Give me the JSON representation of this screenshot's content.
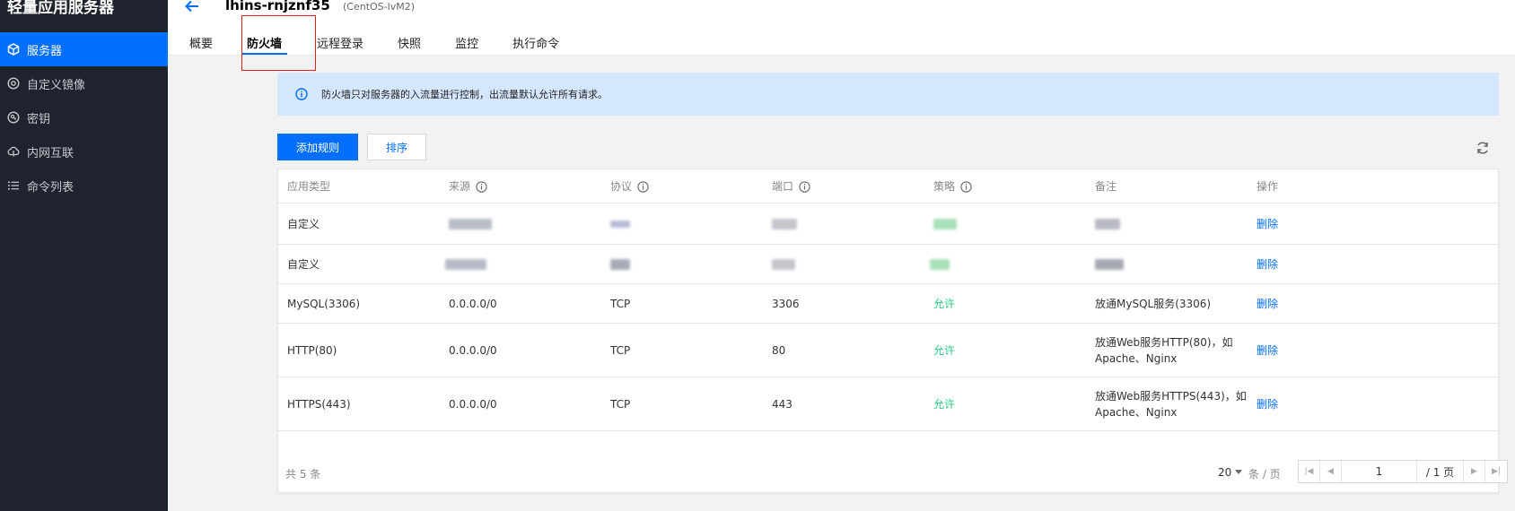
{
  "sidebar": {
    "brand": "轻量应用服务器",
    "items": [
      {
        "label": "服务器",
        "icon": "cube-icon",
        "active": true
      },
      {
        "label": "自定义镜像",
        "icon": "disc-icon",
        "active": false
      },
      {
        "label": "密钥",
        "icon": "key-icon",
        "active": false
      },
      {
        "label": "内网互联",
        "icon": "cloud-link-icon",
        "active": false
      },
      {
        "label": "命令列表",
        "icon": "list-icon",
        "active": false
      }
    ]
  },
  "header": {
    "instance_name": "lhins-rnjznf35",
    "os": "(CentOS-lvM2)",
    "tabs": [
      "概要",
      "防火墙",
      "远程登录",
      "快照",
      "监控",
      "执行命令"
    ],
    "active_tab": "防火墙"
  },
  "notice": {
    "text": "防火墙只对服务器的入流量进行控制，出流量默认允许所有请求。"
  },
  "toolbar": {
    "add_label": "添加规则",
    "sort_label": "排序"
  },
  "table": {
    "columns": [
      "应用类型",
      "来源",
      "协议",
      "端口",
      "策略",
      "备注",
      "操作"
    ],
    "rows": [
      {
        "type": "自定义",
        "source": "",
        "protocol": "",
        "port": "",
        "policy": "",
        "note": "",
        "action": "删除",
        "redacted": true
      },
      {
        "type": "自定义",
        "source": "",
        "protocol": "",
        "port": "",
        "policy": "",
        "note": "",
        "action": "删除",
        "redacted": true
      },
      {
        "type": "MySQL(3306)",
        "source": "0.0.0.0/0",
        "protocol": "TCP",
        "port": "3306",
        "policy": "允许",
        "note": "放通MySQL服务(3306)",
        "action": "删除"
      },
      {
        "type": "HTTP(80)",
        "source": "0.0.0.0/0",
        "protocol": "TCP",
        "port": "80",
        "policy": "允许",
        "note": "放通Web服务HTTP(80)，如Apache、Nginx",
        "action": "删除"
      },
      {
        "type": "HTTPS(443)",
        "source": "0.0.0.0/0",
        "protocol": "TCP",
        "port": "443",
        "policy": "允许",
        "note": "放通Web服务HTTPS(443)，如Apache、Nginx",
        "action": "删除"
      }
    ]
  },
  "footer": {
    "total_label": "共 5 条",
    "page_size": "20",
    "per_page_label": "条 / 页",
    "current_page": "1",
    "page_total_label": "/ 1 页"
  },
  "colors": {
    "accent": "#006eff",
    "sidebar_bg": "#1f232e",
    "allow_green": "#29cc85",
    "notice_bg": "#d5e7ff",
    "highlight_red": "#e2231a"
  }
}
